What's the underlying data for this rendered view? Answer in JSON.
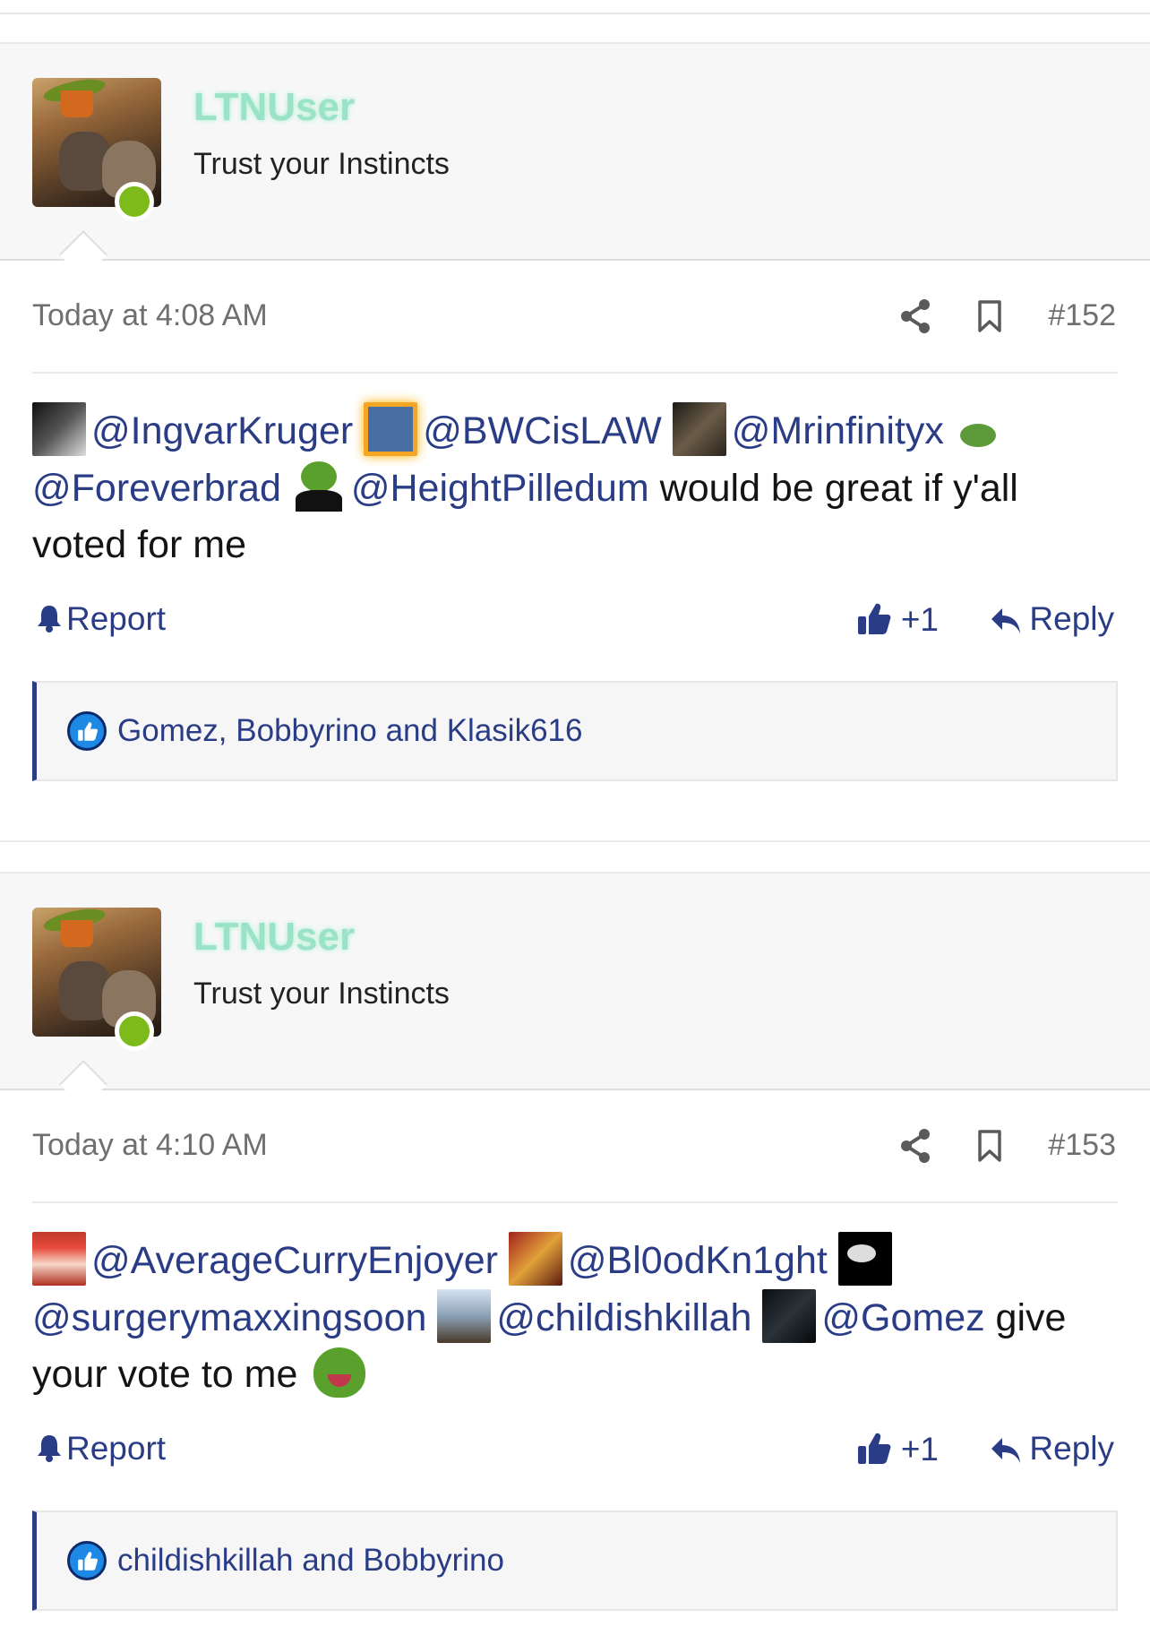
{
  "posts": [
    {
      "username": "LTNUser",
      "user_title": "Trust your Instincts",
      "date": "Today at 4:08 AM",
      "post_number": "#152",
      "mentions": [
        "@IngvarKruger",
        "@BWCisLAW",
        "@Mrinfinityx",
        "@Foreverbrad",
        "@HeightPilledum"
      ],
      "message_tail": " would be great if y'all voted for me",
      "report_label": "Report",
      "like_label": "+1",
      "reply_label": "Reply",
      "reactions_text": "Gomez, Bobbyrino and Klasik616"
    },
    {
      "username": "LTNUser",
      "user_title": "Trust your Instincts",
      "date": "Today at 4:10 AM",
      "post_number": "#153",
      "mentions": [
        "@AverageCurryEnjoyer",
        "@Bl0odKn1ght",
        "@surgerymaxxingsoon",
        "@childishkillah",
        "@Gomez"
      ],
      "message_tail": " give your vote to me",
      "report_label": "Report",
      "like_label": "+1",
      "reply_label": "Reply",
      "reactions_text": "childishkillah and Bobbyrino"
    }
  ],
  "colors": {
    "link": "#2a3c85",
    "username": "#9be3c8",
    "online": "#7cbb1a",
    "meta_text": "#6f6f6f"
  },
  "icons": [
    "share-icon",
    "bookmark-icon",
    "bell-icon",
    "thumbs-up-icon",
    "reply-icon",
    "like-reaction-icon",
    "online-indicator"
  ]
}
